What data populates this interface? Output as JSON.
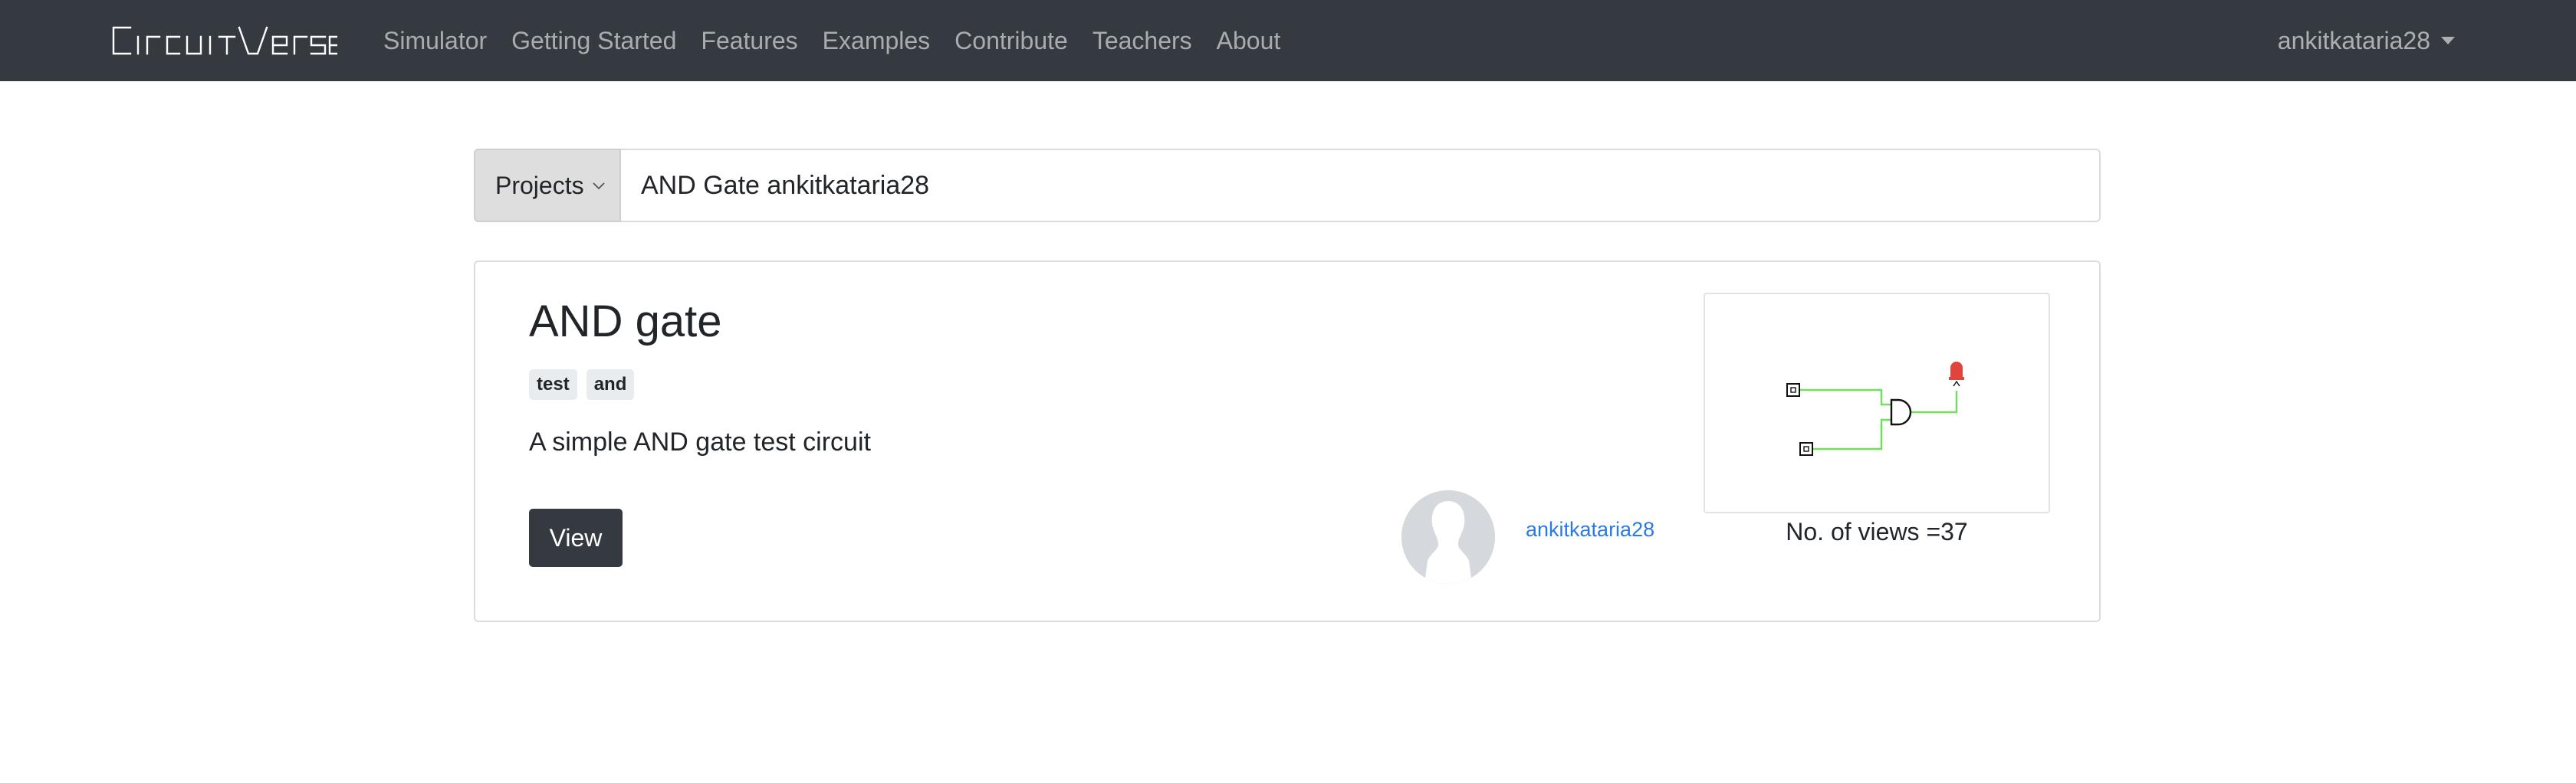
{
  "brand": {
    "name": "CircuitVerse"
  },
  "nav": {
    "links": [
      "Simulator",
      "Getting Started",
      "Features",
      "Examples",
      "Contribute",
      "Teachers",
      "About"
    ],
    "user": "ankitkataria28"
  },
  "search": {
    "category": "Projects",
    "query": "AND Gate ankitkataria28"
  },
  "result": {
    "title": "AND gate",
    "tags": [
      "test",
      "and"
    ],
    "description": "A simple AND gate test circuit",
    "view_label": "View",
    "author": "ankitkataria28",
    "views_text": "No. of views =37"
  },
  "colors": {
    "navbar": "#343a40",
    "link": "#2a7ae2",
    "wire": "#6fe05a",
    "led": "#e0443c"
  }
}
